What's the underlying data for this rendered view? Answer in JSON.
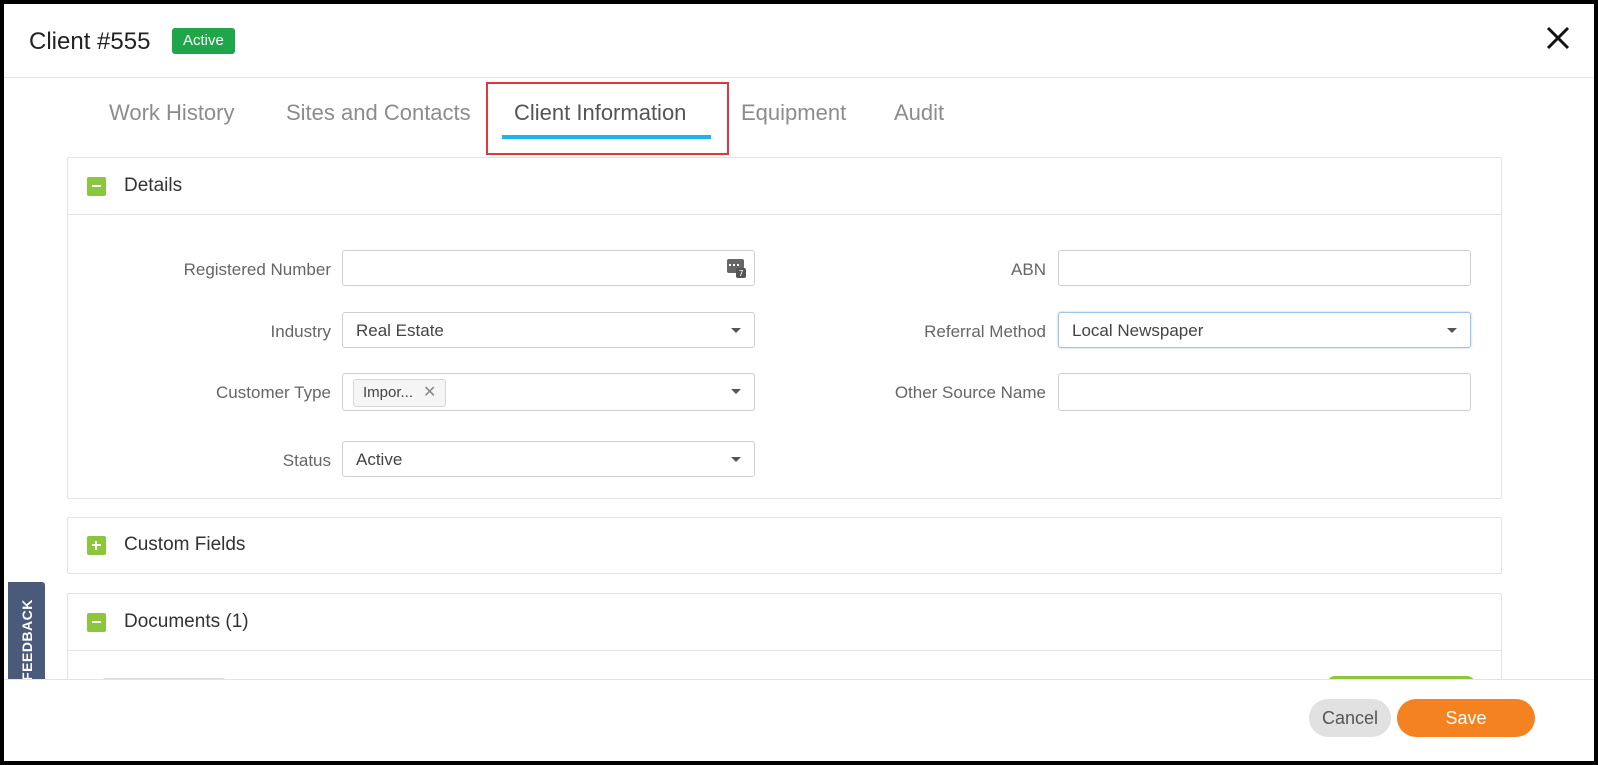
{
  "header": {
    "title": "Client #555",
    "status_badge": "Active",
    "close_icon": "close-icon"
  },
  "tabs": [
    {
      "label": "Work History"
    },
    {
      "label": "Sites and Contacts"
    },
    {
      "label": "Client Information",
      "active": true
    },
    {
      "label": "Equipment"
    },
    {
      "label": "Audit"
    }
  ],
  "details": {
    "title": "Details",
    "toggle": "minus",
    "fields": {
      "registered_number": {
        "label": "Registered Number",
        "value": ""
      },
      "abn": {
        "label": "ABN",
        "value": ""
      },
      "industry": {
        "label": "Industry",
        "value": "Real Estate"
      },
      "referral_method": {
        "label": "Referral Method",
        "value": "Local Newspaper"
      },
      "customer_type": {
        "label": "Customer Type",
        "chip": "Impor..."
      },
      "other_source_name": {
        "label": "Other Source Name",
        "value": ""
      },
      "status": {
        "label": "Status",
        "value": "Active"
      }
    }
  },
  "custom_fields": {
    "title": "Custom Fields",
    "toggle": "plus"
  },
  "documents": {
    "title": "Documents (1)",
    "toggle": "minus"
  },
  "feedback": {
    "label": "FEEDBACK"
  },
  "footer": {
    "cancel_label": "Cancel",
    "save_label": "Save"
  },
  "colors": {
    "accent_tab": "#19b5ec",
    "badge_green": "#1fa64a",
    "toggle_green": "#8cc63f",
    "save_orange": "#f58220",
    "highlight_red": "#e0373c",
    "feedback_bg": "#4a5a7a"
  }
}
